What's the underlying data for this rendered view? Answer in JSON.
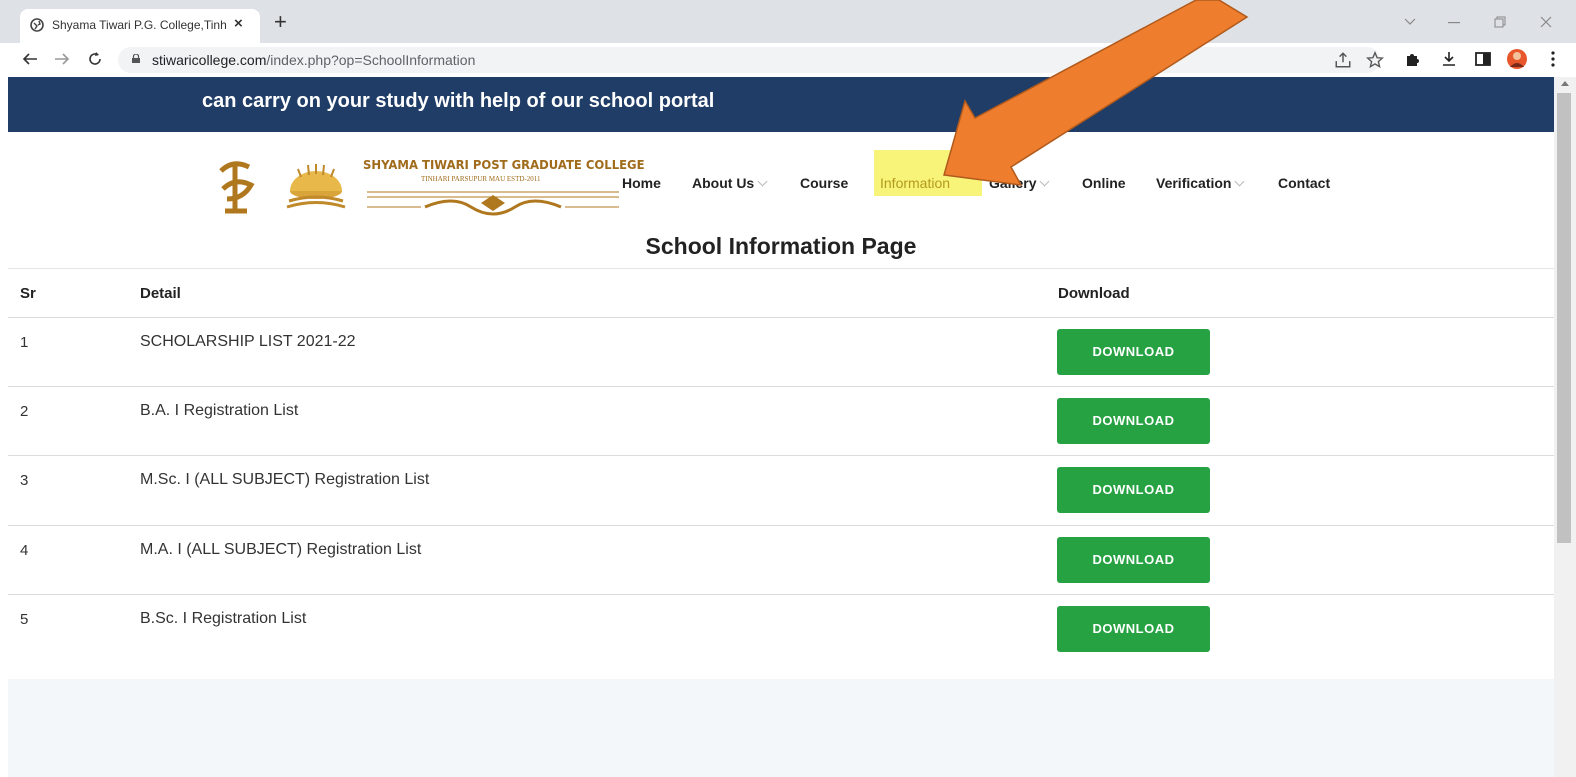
{
  "browser": {
    "tab_title": "Shyama Tiwari P.G. College,Tinha",
    "tab_close": "×",
    "new_tab": "+",
    "url_host": "stiwaricollege.com",
    "url_path": "/index.php?op=SchoolInformation"
  },
  "banner": {
    "text": "can carry on your study with help of our school portal"
  },
  "logo": {
    "name": "SHYAMA TIWARI POST GRADUATE COLLEGE",
    "sub": "TINHARI PARSUPUR MAU ESTD-2011"
  },
  "nav": {
    "items": [
      {
        "label": "Home"
      },
      {
        "label": "About Us"
      },
      {
        "label": "Course"
      },
      {
        "label": "Information"
      },
      {
        "label": "Gallery"
      },
      {
        "label": "Online"
      },
      {
        "label": "Verification"
      },
      {
        "label": "Contact"
      }
    ]
  },
  "page": {
    "title": "School Information Page"
  },
  "table": {
    "headers": {
      "sr": "Sr",
      "detail": "Detail",
      "download": "Download"
    },
    "rows": [
      {
        "sr": "1",
        "detail": "SCHOLARSHIP LIST 2021-22",
        "button": "DOWNLOAD"
      },
      {
        "sr": "2",
        "detail": "B.A. I Registration List",
        "button": "DOWNLOAD"
      },
      {
        "sr": "3",
        "detail": "M.Sc. I (ALL SUBJECT) Registration List",
        "button": "DOWNLOAD"
      },
      {
        "sr": "4",
        "detail": "M.A. I (ALL SUBJECT) Registration List",
        "button": "DOWNLOAD"
      },
      {
        "sr": "5",
        "detail": "B.Sc. I Registration List",
        "button": "DOWNLOAD"
      }
    ]
  },
  "colors": {
    "banner_bg": "#203d67",
    "download_green": "#27a243",
    "highlight_yellow": "#f8f47a",
    "annotation_arrow": "#ee7d2e"
  }
}
